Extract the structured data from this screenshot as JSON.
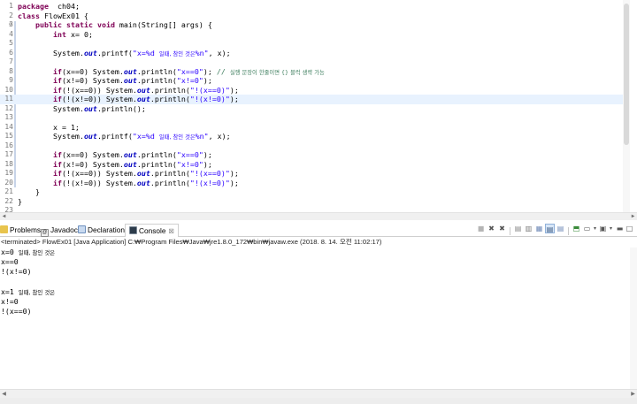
{
  "editor": {
    "lines": [
      {
        "n": "1",
        "parts": [
          [
            "kw",
            "package"
          ],
          [
            "",
            "  ch04;"
          ]
        ]
      },
      {
        "n": "2",
        "parts": [
          [
            "kw",
            "class"
          ],
          [
            "",
            " FlowEx01 {"
          ]
        ]
      },
      {
        "n": "3",
        "parts": [
          [
            "",
            "    "
          ],
          [
            "kw",
            "public"
          ],
          [
            "",
            " "
          ],
          [
            "kw",
            "static"
          ],
          [
            "",
            " "
          ],
          [
            "kw",
            "void"
          ],
          [
            "",
            " main(String[] args) {"
          ]
        ]
      },
      {
        "n": "4",
        "parts": [
          [
            "",
            "        "
          ],
          [
            "kw",
            "int"
          ],
          [
            "",
            " x= 0;"
          ]
        ]
      },
      {
        "n": "5",
        "parts": []
      },
      {
        "n": "6",
        "parts": [
          [
            "",
            "        System."
          ],
          [
            "sf",
            "out"
          ],
          [
            "",
            ".printf("
          ],
          [
            "st",
            "\"x=%d "
          ],
          [
            "st sm",
            "일때, 참인 것은"
          ],
          [
            "st",
            "%n\""
          ],
          [
            "",
            ", x);"
          ]
        ]
      },
      {
        "n": "7",
        "parts": []
      },
      {
        "n": "8",
        "parts": [
          [
            "",
            "        "
          ],
          [
            "kw",
            "if"
          ],
          [
            "",
            "(x==0) System."
          ],
          [
            "sf",
            "out"
          ],
          [
            "",
            ".println("
          ],
          [
            "st",
            "\"x==0\""
          ],
          [
            "",
            "); "
          ],
          [
            "cm",
            "// "
          ],
          [
            "cm sm",
            "실행 문장이 한줄이면 {} 블럭 생략 가능"
          ]
        ]
      },
      {
        "n": "9",
        "parts": [
          [
            "",
            "        "
          ],
          [
            "kw",
            "if"
          ],
          [
            "",
            "(x!=0) System."
          ],
          [
            "sf",
            "out"
          ],
          [
            "",
            ".println("
          ],
          [
            "st",
            "\"x!=0\""
          ],
          [
            "",
            ");"
          ]
        ]
      },
      {
        "n": "10",
        "parts": [
          [
            "",
            "        "
          ],
          [
            "kw",
            "if"
          ],
          [
            "",
            "(!(x==0)) System."
          ],
          [
            "sf",
            "out"
          ],
          [
            "",
            ".println("
          ],
          [
            "st",
            "\"!(x==0)\""
          ],
          [
            "",
            ");"
          ]
        ]
      },
      {
        "n": "11",
        "parts": [
          [
            "",
            "        "
          ],
          [
            "kw",
            "if"
          ],
          [
            "",
            "(!(x!=0)) System."
          ],
          [
            "sf",
            "out"
          ],
          [
            "",
            ".println("
          ],
          [
            "st",
            "\"!(x!=0)\""
          ],
          [
            "",
            ");"
          ]
        ],
        "current": true
      },
      {
        "n": "12",
        "parts": [
          [
            "",
            "        System."
          ],
          [
            "sf",
            "out"
          ],
          [
            "",
            ".println();"
          ]
        ]
      },
      {
        "n": "13",
        "parts": []
      },
      {
        "n": "14",
        "parts": [
          [
            "",
            "        x = 1;"
          ]
        ]
      },
      {
        "n": "15",
        "parts": [
          [
            "",
            "        System."
          ],
          [
            "sf",
            "out"
          ],
          [
            "",
            ".printf("
          ],
          [
            "st",
            "\"x=%d "
          ],
          [
            "st sm",
            "일때, 참인 것은"
          ],
          [
            "st",
            "%n\""
          ],
          [
            "",
            ", x);"
          ]
        ]
      },
      {
        "n": "16",
        "parts": []
      },
      {
        "n": "17",
        "parts": [
          [
            "",
            "        "
          ],
          [
            "kw",
            "if"
          ],
          [
            "",
            "(x==0) System."
          ],
          [
            "sf",
            "out"
          ],
          [
            "",
            ".println("
          ],
          [
            "st",
            "\"x==0\""
          ],
          [
            "",
            ");"
          ]
        ]
      },
      {
        "n": "18",
        "parts": [
          [
            "",
            "        "
          ],
          [
            "kw",
            "if"
          ],
          [
            "",
            "(x!=0) System."
          ],
          [
            "sf",
            "out"
          ],
          [
            "",
            ".println("
          ],
          [
            "st",
            "\"x!=0\""
          ],
          [
            "",
            ");"
          ]
        ]
      },
      {
        "n": "19",
        "parts": [
          [
            "",
            "        "
          ],
          [
            "kw",
            "if"
          ],
          [
            "",
            "(!(x==0)) System."
          ],
          [
            "sf",
            "out"
          ],
          [
            "",
            ".println("
          ],
          [
            "st",
            "\"!(x==0)\""
          ],
          [
            "",
            ");"
          ]
        ]
      },
      {
        "n": "20",
        "parts": [
          [
            "",
            "        "
          ],
          [
            "kw",
            "if"
          ],
          [
            "",
            "(!(x!=0)) System."
          ],
          [
            "sf",
            "out"
          ],
          [
            "",
            ".println("
          ],
          [
            "st",
            "\"!(x!=0)\""
          ],
          [
            "",
            ");"
          ]
        ]
      },
      {
        "n": "21",
        "parts": [
          [
            "",
            "    }"
          ]
        ]
      },
      {
        "n": "22",
        "parts": [
          [
            "",
            "}"
          ]
        ]
      },
      {
        "n": "23",
        "parts": []
      }
    ]
  },
  "tabs": {
    "problems": "Problems",
    "javadoc": "Javadoc",
    "declaration": "Declaration",
    "console": "Console",
    "console_close": "☒"
  },
  "console": {
    "header": "<terminated> FlowEx01 [Java Application] C:₩Program Files₩Java₩jre1.8.0_172₩bin₩javaw.exe (2018. 8. 14. 오전 11:02:17)",
    "lines": [
      {
        "parts": [
          [
            "",
            "x=0 "
          ],
          [
            "sm",
            "일때, 참인 것은"
          ]
        ]
      },
      {
        "parts": [
          [
            "",
            "x==0"
          ]
        ]
      },
      {
        "parts": [
          [
            "",
            "!(x!=0)"
          ]
        ]
      },
      {
        "parts": []
      },
      {
        "parts": [
          [
            "",
            "x=1 "
          ],
          [
            "sm",
            "일때, 참인 것은"
          ]
        ]
      },
      {
        "parts": [
          [
            "",
            "x!=0"
          ]
        ]
      },
      {
        "parts": [
          [
            "",
            "!(x==0)"
          ]
        ]
      }
    ]
  },
  "colors": {
    "keyword": "#7f0055",
    "string": "#2a00ff",
    "static_field": "#0000c0",
    "comment": "#3f7f5f",
    "current_line": "#e8f2fe"
  },
  "toolbar_icons": [
    "terminate-icon",
    "remove-launch-icon",
    "remove-all-icon",
    "lock-scroll-icon",
    "scroll-lock-icon",
    "word-wrap-icon",
    "pin-console-icon",
    "display-selected-console-icon",
    "open-console-icon",
    "minimize-icon",
    "maximize-icon"
  ]
}
